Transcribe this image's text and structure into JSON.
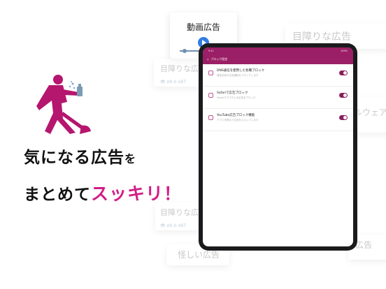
{
  "headline": {
    "line1_a": "気になる広告",
    "line1_b": "を",
    "line2_a": "まとめて",
    "line2_b": "スッキリ！",
    "accent_color": "#d31c86"
  },
  "bg_cards": {
    "video": {
      "label": "動画広告"
    },
    "top_right": {
      "label": "目障りな広告"
    },
    "left_mid": {
      "label": "目障りな広告",
      "meta": "👁 x9   ⊙ x97"
    },
    "right_mid": {
      "label": "ルウェア"
    },
    "left_bottom": {
      "label": "目障りな広告",
      "meta": "👁 x9   ⊙ x97"
    },
    "bottom": {
      "label": "怪しい広告"
    },
    "right_bottom": {
      "label": "広告"
    }
  },
  "tablet": {
    "status_time": "9:41",
    "status_right": "100%",
    "nav_title": "ブロック設定",
    "theme_color": "#9b1f66",
    "rows": [
      {
        "title": "DNS通信を使用した各種ブロック",
        "subtitle": "端末全体の広告通信をブロックします",
        "enabled": true
      },
      {
        "title": "Safariで広告ブロック",
        "subtitle": "Safariブラウザ上の広告をブロック",
        "enabled": true
      },
      {
        "title": "YouTube広告ブロック機能",
        "subtitle": "アプリ内再生で広告をスキップします",
        "enabled": true
      }
    ]
  },
  "icons": {
    "figure": "cleaning-person-icon",
    "row_icon": "shield-icon",
    "back": "chevron-left-icon"
  }
}
